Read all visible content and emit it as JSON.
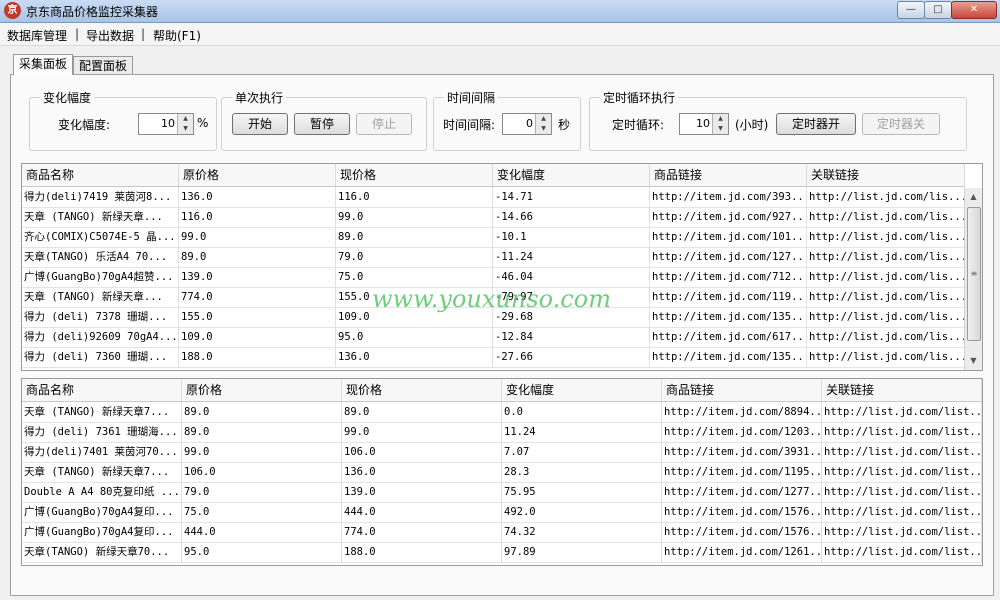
{
  "window": {
    "title": "京东商品价格监控采集器",
    "icon": "app-logo-icon",
    "minimize": "—",
    "maximize": "□",
    "close": "✕"
  },
  "menu": {
    "items": [
      "数据库管理",
      "导出数据",
      "帮助(F1)"
    ],
    "separator": "|"
  },
  "tabs": [
    {
      "label": "采集面板",
      "active": true
    },
    {
      "label": "配置面板",
      "active": false
    }
  ],
  "groups": {
    "change": {
      "title": "变化幅度",
      "label": "变化幅度:",
      "value": "10",
      "unit": "%"
    },
    "single": {
      "title": "单次执行",
      "start": "开始",
      "pause": "暂停",
      "stop": "停止"
    },
    "interval": {
      "title": "时间间隔",
      "label": "时间间隔:",
      "value": "0",
      "unit": "秒"
    },
    "loop": {
      "title": "定时循环执行",
      "label": "定时循环:",
      "value": "10",
      "unit": "(小时)",
      "timer_on": "定时器开",
      "timer_off": "定时器关"
    }
  },
  "columns": [
    "商品名称",
    "原价格",
    "现价格",
    "变化幅度",
    "商品链接",
    "关联链接"
  ],
  "table1": [
    [
      "得力(deli)7419 莱茵河8...",
      "136.0",
      "116.0",
      "-14.71",
      "http://item.jd.com/393...",
      "http://list.jd.com/lis..."
    ],
    [
      "天章 (TANGO) 新绿天章...",
      "116.0",
      "99.0",
      "-14.66",
      "http://item.jd.com/927...",
      "http://list.jd.com/lis..."
    ],
    [
      "齐心(COMIX)C5074E-5 晶...",
      "99.0",
      "89.0",
      "-10.1",
      "http://item.jd.com/101...",
      "http://list.jd.com/lis..."
    ],
    [
      "天章(TANGO) 乐活A4 70...",
      "89.0",
      "79.0",
      "-11.24",
      "http://item.jd.com/127...",
      "http://list.jd.com/lis..."
    ],
    [
      "广博(GuangBo)70gA4超赞...",
      "139.0",
      "75.0",
      "-46.04",
      "http://item.jd.com/712...",
      "http://list.jd.com/lis..."
    ],
    [
      "天章 (TANGO) 新绿天章...",
      "774.0",
      "155.0",
      "-79.97",
      "http://item.jd.com/119...",
      "http://list.jd.com/lis..."
    ],
    [
      "得力 (deli) 7378 珊瑚...",
      "155.0",
      "109.0",
      "-29.68",
      "http://item.jd.com/135...",
      "http://list.jd.com/lis..."
    ],
    [
      "得力 (deli)92609 70gA4...",
      "109.0",
      "95.0",
      "-12.84",
      "http://item.jd.com/617...",
      "http://list.jd.com/lis..."
    ],
    [
      "得力 (deli) 7360 珊瑚...",
      "188.0",
      "136.0",
      "-27.66",
      "http://item.jd.com/135...",
      "http://list.jd.com/lis..."
    ]
  ],
  "table2": [
    [
      "天章 (TANGO) 新绿天章7...",
      "89.0",
      "89.0",
      "0.0",
      "http://item.jd.com/8894...",
      "http://list.jd.com/list..."
    ],
    [
      "得力 (deli) 7361 珊瑚海...",
      "89.0",
      "99.0",
      "11.24",
      "http://item.jd.com/1203...",
      "http://list.jd.com/list..."
    ],
    [
      "得力(deli)7401 莱茵河70...",
      "99.0",
      "106.0",
      "7.07",
      "http://item.jd.com/3931...",
      "http://list.jd.com/list..."
    ],
    [
      "天章 (TANGO) 新绿天章7...",
      "106.0",
      "136.0",
      "28.3",
      "http://item.jd.com/1195...",
      "http://list.jd.com/list..."
    ],
    [
      "Double A A4 80克复印纸 ...",
      "79.0",
      "139.0",
      "75.95",
      "http://item.jd.com/1277...",
      "http://list.jd.com/list..."
    ],
    [
      "广博(GuangBo)70gA4复印...",
      "75.0",
      "444.0",
      "492.0",
      "http://item.jd.com/1576...",
      "http://list.jd.com/list..."
    ],
    [
      "广博(GuangBo)70gA4复印...",
      "444.0",
      "774.0",
      "74.32",
      "http://item.jd.com/1576...",
      "http://list.jd.com/list..."
    ],
    [
      "天章(TANGO) 新绿天章70...",
      "95.0",
      "188.0",
      "97.89",
      "http://item.jd.com/1261...",
      "http://list.jd.com/list..."
    ]
  ],
  "scrollbar": {
    "up": "▲",
    "down": "▼",
    "grip": "≡"
  },
  "watermark": "www.youxunso.com"
}
